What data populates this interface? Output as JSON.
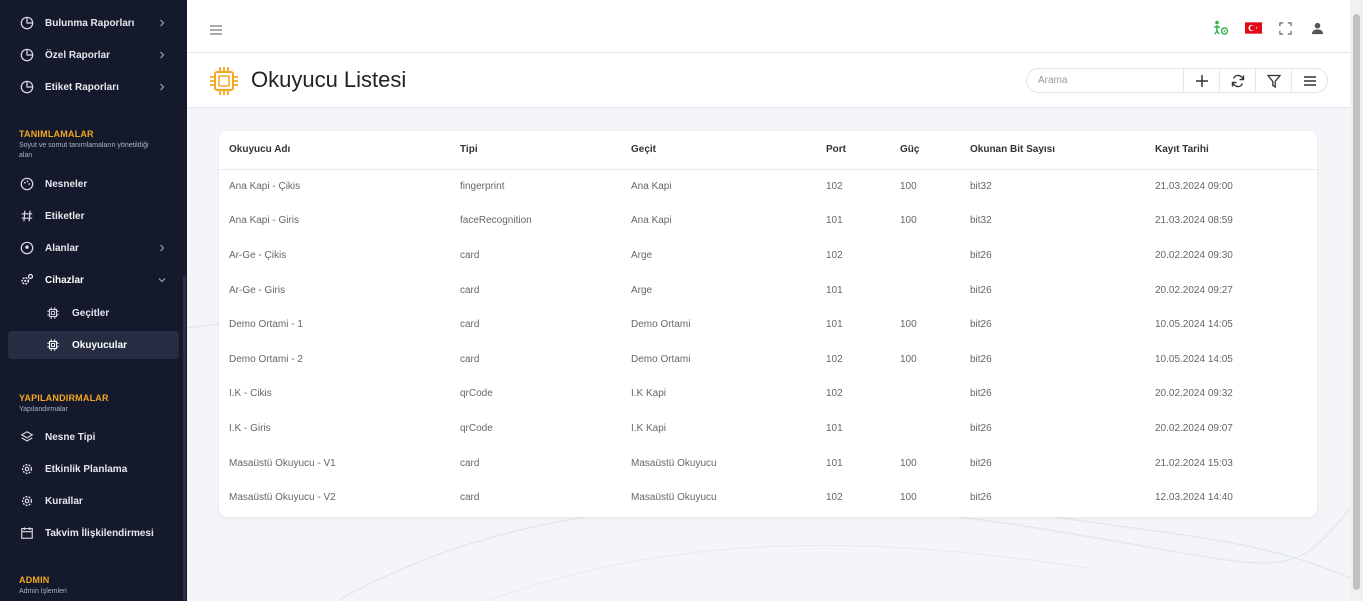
{
  "sidebar": {
    "top_items": [
      {
        "label": "Bulunma Raporları",
        "icon": "chart-pie-icon"
      },
      {
        "label": "Özel Raporlar",
        "icon": "chart-pie-icon"
      },
      {
        "label": "Etiket Raporları",
        "icon": "chart-pie-icon"
      }
    ],
    "sections": [
      {
        "title": "TANIMLAMALAR",
        "subtitle": "Soyut ve somut tanımlamaların yönetildiği alan"
      },
      {
        "title": "YAPILANDIRMALAR",
        "subtitle": "Yapılandırmalar"
      },
      {
        "title": "ADMIN",
        "subtitle": "Admin İşlemleri"
      }
    ],
    "def_items": [
      {
        "label": "Nesneler"
      },
      {
        "label": "Etiketler"
      },
      {
        "label": "Alanlar"
      },
      {
        "label": "Cihazlar"
      },
      {
        "label": "Geçitler"
      },
      {
        "label": "Okuyucular"
      }
    ],
    "config_items": [
      {
        "label": "Nesne Tipi"
      },
      {
        "label": "Etkinlik Planlama"
      },
      {
        "label": "Kurallar"
      },
      {
        "label": "Takvim İlişkilendirmesi"
      }
    ]
  },
  "page": {
    "title": "Okuyucu Listesi",
    "search_placeholder": "Arama"
  },
  "colors": {
    "sidebar_bg": "#14192c",
    "accent": "#f5a623",
    "status_green": "#2db34a",
    "flag_red": "#e30a17"
  },
  "table": {
    "headers": [
      "Okuyucu Adı",
      "Tipi",
      "Geçit",
      "Port",
      "Güç",
      "Okunan Bit Sayısı",
      "Kayıt Tarihi"
    ],
    "rows": [
      [
        "Ana Kapi - Çikis",
        "fingerprint",
        "Ana Kapi",
        "102",
        "100",
        "bit32",
        "21.03.2024 09:00"
      ],
      [
        "Ana Kapi - Giris",
        "faceRecognition",
        "Ana Kapi",
        "101",
        "100",
        "bit32",
        "21.03.2024 08:59"
      ],
      [
        "Ar-Ge - Çikis",
        "card",
        "Arge",
        "102",
        "",
        "bit26",
        "20.02.2024 09:30"
      ],
      [
        "Ar-Ge - Giris",
        "card",
        "Arge",
        "101",
        "",
        "bit26",
        "20.02.2024 09:27"
      ],
      [
        "Demo Ortami - 1",
        "card",
        "Demo Ortami",
        "101",
        "100",
        "bit26",
        "10.05.2024 14:05"
      ],
      [
        "Demo Ortami - 2",
        "card",
        "Demo Ortami",
        "102",
        "100",
        "bit26",
        "10.05.2024 14:05"
      ],
      [
        "I.K - Cikis",
        "qrCode",
        "I.K Kapi",
        "102",
        "",
        "bit26",
        "20.02.2024 09:32"
      ],
      [
        "I.K - Giris",
        "qrCode",
        "I.K Kapi",
        "101",
        "",
        "bit26",
        "20.02.2024 09:07"
      ],
      [
        "Masaüstü Okuyucu - V1",
        "card",
        "Masaüstü Okuyucu",
        "101",
        "100",
        "bit26",
        "21.02.2024 15:03"
      ],
      [
        "Masaüstü Okuyucu - V2",
        "card",
        "Masaüstü Okuyucu",
        "102",
        "100",
        "bit26",
        "12.03.2024 14:40"
      ]
    ]
  }
}
